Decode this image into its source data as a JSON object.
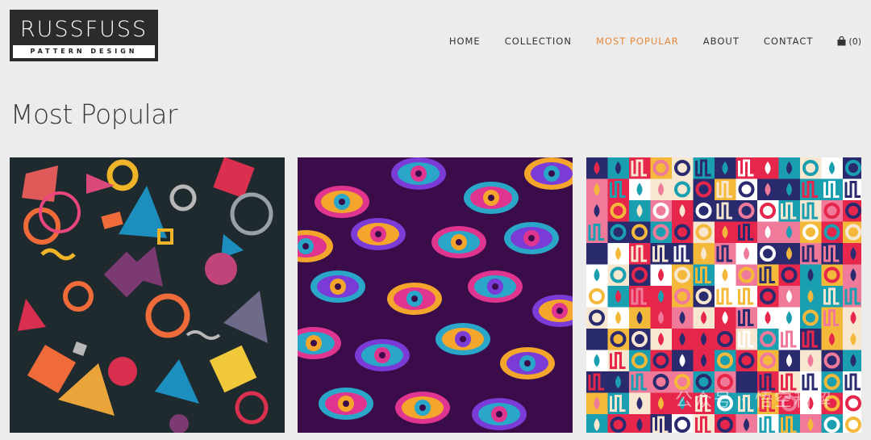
{
  "brand": {
    "title": "RUSSFUSS",
    "subtitle": "PATTERN DESIGN"
  },
  "nav": {
    "items": [
      {
        "label": "HOME"
      },
      {
        "label": "COLLECTION"
      },
      {
        "label": "MOST POPULAR",
        "active": true
      },
      {
        "label": "ABOUT"
      },
      {
        "label": "CONTACT"
      }
    ],
    "cart_count": "(0)",
    "cart_icon": "shopping-bag-icon",
    "active_color": "#e8883a"
  },
  "page": {
    "title": "Most Popular"
  },
  "products": [
    {
      "pattern": "geometric-shapes",
      "background": "#1f2a2e"
    },
    {
      "pattern": "evil-eyes",
      "background": "#3a0d4a"
    },
    {
      "pattern": "colorful-tiles",
      "background": "#f4b93a"
    }
  ],
  "watermark": "公众号 · 悟空和解"
}
